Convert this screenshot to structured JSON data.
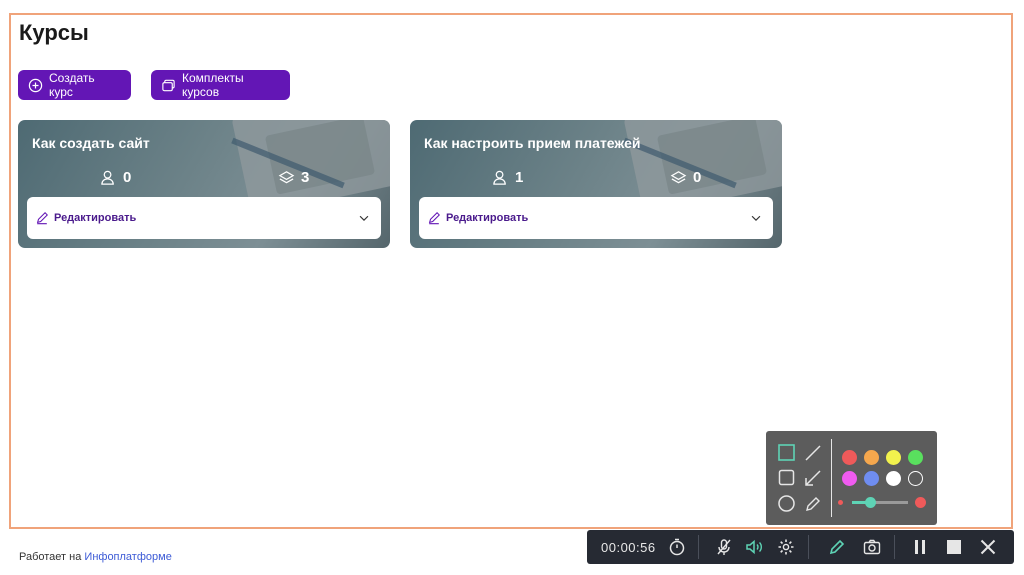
{
  "page": {
    "title": "Курсы"
  },
  "toolbar": {
    "create_label": "Создать курс",
    "sets_label": "Комплекты курсов"
  },
  "courses": [
    {
      "title": "Как создать сайт",
      "students": "0",
      "modules": "3",
      "edit_label": "Редактировать"
    },
    {
      "title": "Как настроить прием платежей",
      "students": "1",
      "modules": "0",
      "edit_label": "Редактировать"
    }
  ],
  "footer": {
    "prefix": "Работает на",
    "link": "Инфоплатформе"
  },
  "recorder": {
    "timer": "00:00:56",
    "palette": [
      "#ef5a5a",
      "#f5a74d",
      "#f2f24d",
      "#59e05e",
      "#f05bf0",
      "#6f8df0",
      "#ffffff",
      "transparent"
    ]
  },
  "colors": {
    "accent": "#6316b5",
    "frame": "#f0a37a",
    "recorder_green": "#5ed3b5"
  }
}
